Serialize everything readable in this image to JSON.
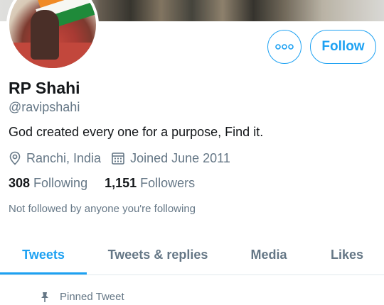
{
  "profile": {
    "name": "RP Shahi",
    "handle": "@ravipshahi",
    "bio": "God created every one for a purpose, Find it.",
    "location": "Ranchi, India",
    "joined": "Joined June 2011",
    "following_count": "308",
    "following_label": "Following",
    "followers_count": "1,151",
    "followers_label": "Followers",
    "not_followed_text": "Not followed by anyone you're following"
  },
  "actions": {
    "more_icon": "more-dots-icon",
    "follow_label": "Follow"
  },
  "tabs": [
    {
      "label": "Tweets",
      "active": true
    },
    {
      "label": "Tweets & replies",
      "active": false
    },
    {
      "label": "Media",
      "active": false
    },
    {
      "label": "Likes",
      "active": false
    }
  ],
  "pinned": {
    "label": "Pinned Tweet",
    "icon": "pin-icon"
  },
  "icons": {
    "location": "location-pin-icon",
    "calendar": "calendar-icon"
  },
  "colors": {
    "accent": "#1da1f2",
    "secondary_text": "#657786",
    "primary_text": "#14171a"
  }
}
